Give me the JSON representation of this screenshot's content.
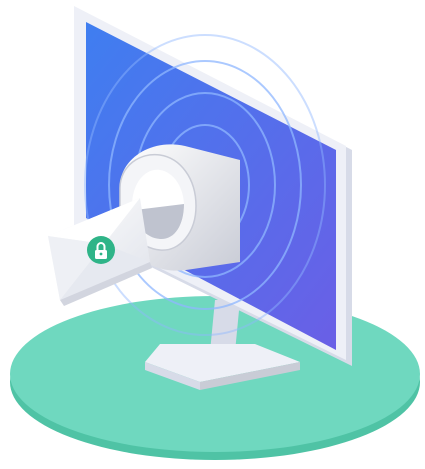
{
  "illustration": {
    "subject": "secure-email-monitor",
    "icons": [
      "monitor-icon",
      "mailbox-icon",
      "envelope-icon",
      "lock-icon"
    ]
  },
  "colors": {
    "background": "#ffffff",
    "base_top": "#6fd8bf",
    "base_side": "#4fc3a5",
    "monitor_frame": "#eef0f7",
    "monitor_frame_edge": "#d7dbe8",
    "screen_top": "#3f7ef0",
    "screen_bottom": "#6a5fe6",
    "ripple": "#8fb7ff",
    "mailbox_light": "#f4f5f8",
    "mailbox_shadow": "#c9ccd6",
    "envelope": "#f7f8fb",
    "envelope_shadow": "#d2d5df",
    "lock_badge": "#2fb488",
    "lock_glyph": "#ffffff"
  }
}
